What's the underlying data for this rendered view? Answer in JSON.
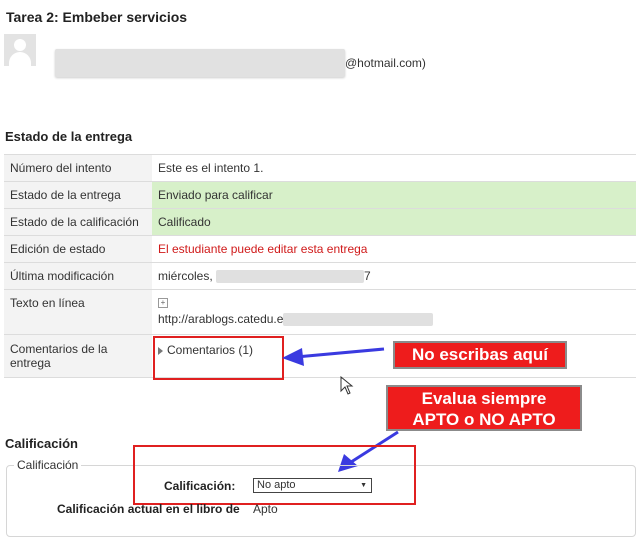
{
  "page": {
    "title": "Tarea 2: Embeber servicios",
    "user_email_suffix": "@hotmail.com)"
  },
  "submission": {
    "heading": "Estado de la entrega",
    "rows": [
      {
        "label": "Número del intento",
        "value": "Este es el intento 1."
      },
      {
        "label": "Estado de la entrega",
        "value": "Enviado para calificar"
      },
      {
        "label": "Estado de la calificación",
        "value": "Calificado"
      },
      {
        "label": "Edición de estado",
        "value": "El estudiante puede editar esta entrega"
      },
      {
        "label": "Última modificación",
        "value": "miércoles,",
        "value_suffix": "7"
      },
      {
        "label": "Texto en línea",
        "value": "http://arablogs.catedu.e"
      },
      {
        "label": "Comentarios de la entrega",
        "value": "Comentarios (1)"
      }
    ],
    "status_color": "#d7f0c9",
    "alert_color": "#d01a1a"
  },
  "annotations": {
    "no_write": "No escribas aquí",
    "evaluate_line1": "Evalua siempre",
    "evaluate_line2": "APTO o NO APTO",
    "accent_color": "#ee1c1c",
    "arrow_color": "#3a3ae0"
  },
  "grading": {
    "heading": "Calificación",
    "fieldset_legend": "Calificación",
    "grade_label": "Calificación:",
    "grade_selected": "No apto",
    "gradebook_label": "Calificación actual en el libro de",
    "gradebook_value": "Apto"
  }
}
